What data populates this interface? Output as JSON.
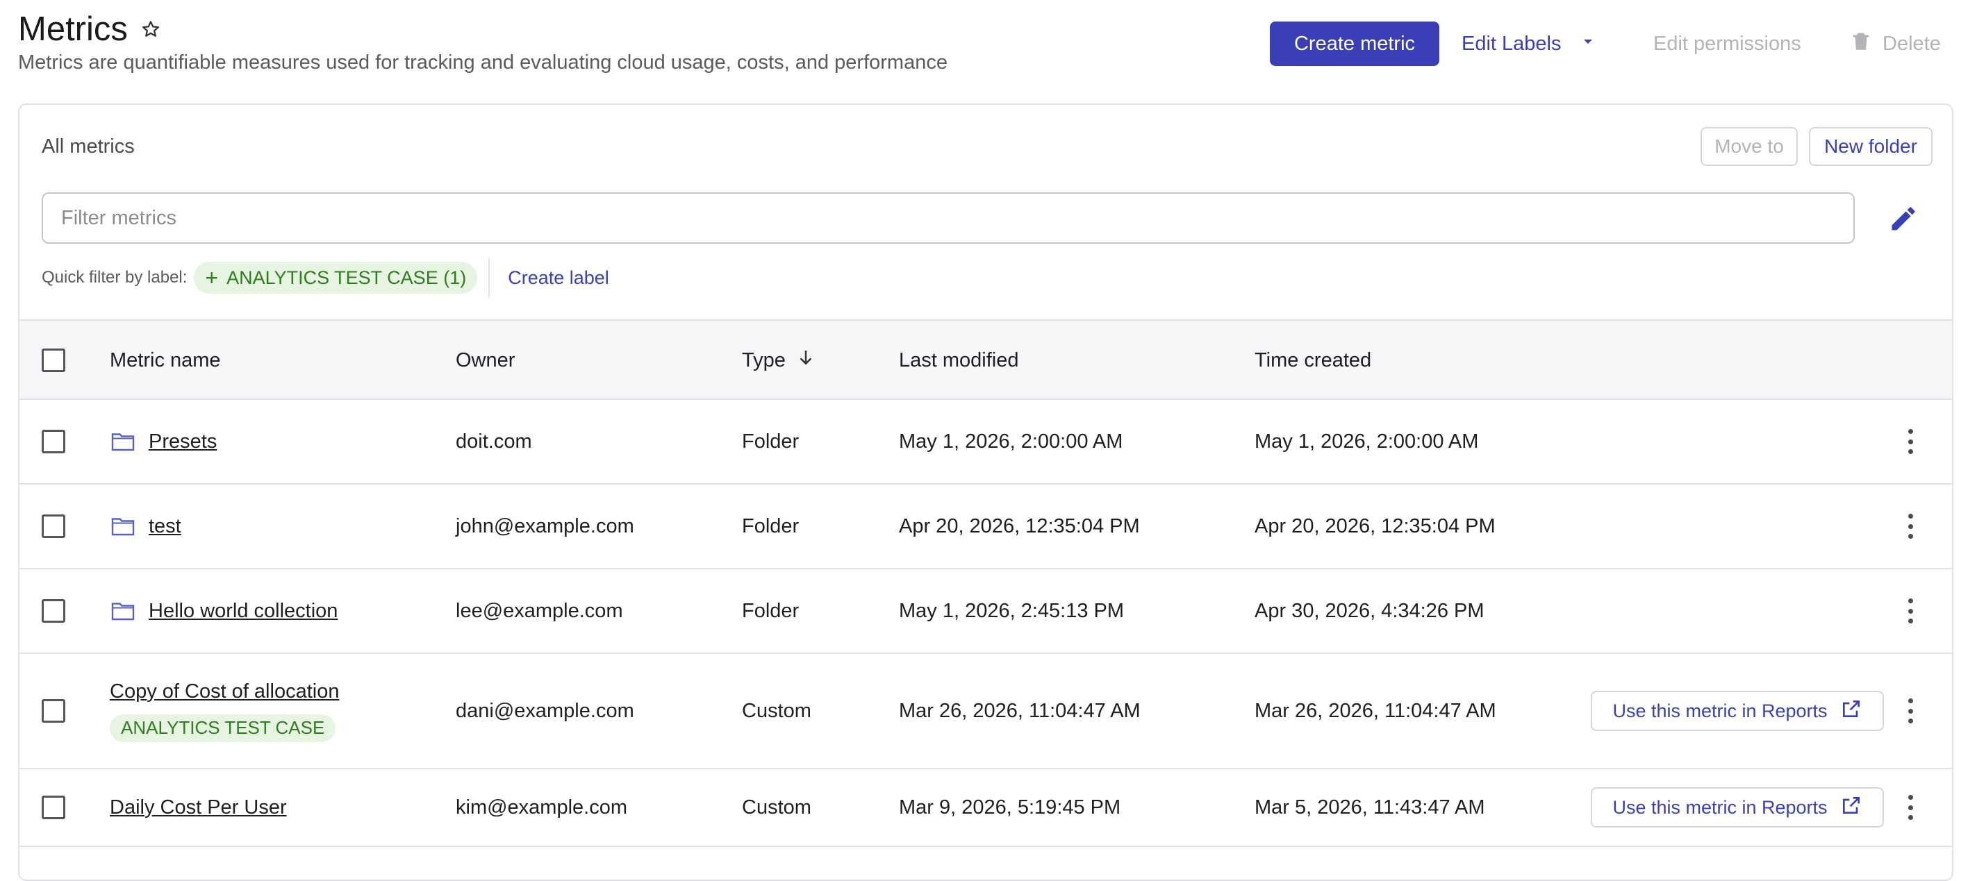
{
  "header": {
    "title": "Metrics",
    "subtitle": "Metrics are quantifiable measures used for tracking and evaluating cloud usage, costs, and performance",
    "create_button": "Create metric",
    "edit_labels": "Edit Labels",
    "edit_permissions": "Edit permissions",
    "delete": "Delete"
  },
  "card": {
    "title": "All metrics",
    "move_to": "Move to",
    "new_folder": "New folder",
    "filter_placeholder": "Filter metrics",
    "quick_filter_label": "Quick filter by label:",
    "quick_filter_chip": "ANALYTICS TEST CASE (1)",
    "create_label": "Create label"
  },
  "table": {
    "columns": {
      "name": "Metric name",
      "owner": "Owner",
      "type": "Type",
      "last_modified": "Last modified",
      "time_created": "Time created"
    },
    "rows": [
      {
        "name": "Presets",
        "owner": "doit.com",
        "type": "Folder",
        "last_modified": "May 1, 2026, 2:00:00 AM",
        "time_created": "May 1, 2026, 2:00:00 AM"
      },
      {
        "name": "test",
        "owner": "john@example.com",
        "type": "Folder",
        "last_modified": "Apr 20, 2026, 12:35:04 PM",
        "time_created": "Apr 20, 2026, 12:35:04 PM"
      },
      {
        "name": "Hello world collection",
        "owner": "lee@example.com",
        "type": "Folder",
        "last_modified": "May 1, 2026, 2:45:13 PM",
        "time_created": "Apr 30, 2026, 4:34:26 PM"
      },
      {
        "name": "Copy of Cost of allocation",
        "tag": "ANALYTICS TEST CASE",
        "owner": "dani@example.com",
        "type": "Custom",
        "last_modified": "Mar 26, 2026, 11:04:47 AM",
        "time_created": "Mar 26, 2026, 11:04:47 AM",
        "action": "Use this metric in Reports"
      },
      {
        "name": "Daily Cost Per User",
        "owner": "kim@example.com",
        "type": "Custom",
        "last_modified": "Mar 9, 2026, 5:19:45 PM",
        "time_created": "Mar 5, 2026, 11:43:47 AM",
        "action": "Use this metric in Reports"
      }
    ]
  },
  "colors": {
    "primary": "#3b3fb6",
    "label_bg": "#e6f4e1",
    "label_text": "#2e7d1e",
    "disabled": "#b3b3b8"
  },
  "icons": [
    "star-icon",
    "chevron-down-icon",
    "trash-icon",
    "pencil-icon",
    "plus-icon",
    "folder-icon",
    "arrow-down-icon",
    "external-link-icon",
    "kebab-icon"
  ]
}
